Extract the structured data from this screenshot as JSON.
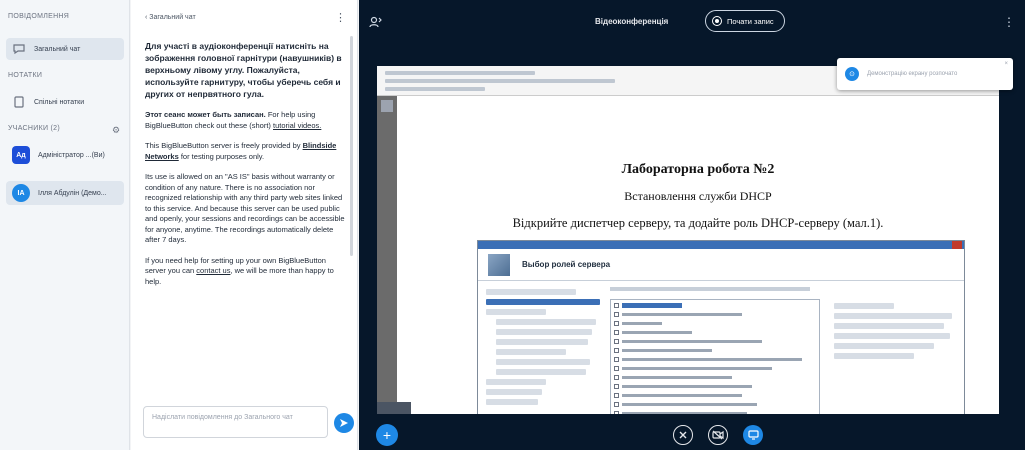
{
  "userlist": {
    "messages_title": "ПОВІДОМЛЕННЯ",
    "public_chat": "Загальний чат",
    "notes_title": "НОТАТКИ",
    "shared_notes": "Спільні нотатки",
    "users_title": "УЧАСНИКИ (2)",
    "users": [
      {
        "initials": "Ад",
        "name": "Адміністратор ...(Ви)",
        "color": "#1d4ed8"
      },
      {
        "initials": "ІА",
        "name": "Ілля Абдулін (Демо...",
        "color": "#1e88e5"
      }
    ]
  },
  "chat": {
    "back_label": "‹ Загальний чат",
    "welcome_bold": "Для участі в аудіоконференції натисніть на зображення головної гарнітури (навушників) в верхньому лівому углу. Пожалуйста, используйте гарнитуру, чтобы уберечь себя и других от непрвятного гула.",
    "rec_bold": "Этот сеанс может быть записан.",
    "rec_text": " For help using BigBlueButton check out these (short) ",
    "rec_link": "tutorial videos.",
    "server_text": "This BigBlueButton server is freely provided by ",
    "server_link": "Blindside Networks",
    "server_tail": " for testing purposes only.",
    "asis_text": "Its use is allowed on an \"AS IS\" basis without warranty or condition of any nature. There is no association nor recognized relationship with any third party web sites linked to this service. And because this server can be used public and openly, your sessions and recordings can be accessible for anyone, anytime. The recordings automatically delete after 7 days.",
    "help_text": "If you need help for setting up your own BigBlueButton server you can ",
    "help_link": "contact us",
    "help_tail": ", we will be more than happy to help.",
    "input_placeholder": "Надіслати повідомлення до Загального чат"
  },
  "topbar": {
    "title": "Відеоконференція",
    "record_label": "Почати запис"
  },
  "slide": {
    "title": "Лабораторна робота №2",
    "subtitle": "Встановлення служби DHCP",
    "body": "Відкрийте диспетчер серверу, та додайте роль DHCP-серверу (мал.1).",
    "window_title": "Выбор ролей сервера"
  },
  "toast": {
    "text": "Демонстрацію екрану розпочато"
  },
  "colors": {
    "accent": "#1e88e5",
    "main_bg": "#06172a"
  },
  "icons": {
    "chat": "chat-bubble-icon",
    "notes": "notes-icon",
    "settings": "gear-icon",
    "users_toggle": "users-icon",
    "more": "kebab-icon",
    "record": "record-icon",
    "send": "send-icon",
    "add": "plus-icon",
    "mic": "mic-muted-icon",
    "camera": "camera-off-icon",
    "screen": "screen-share-icon"
  }
}
